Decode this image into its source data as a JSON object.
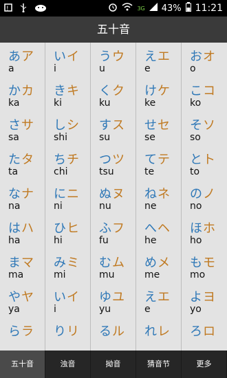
{
  "status": {
    "battery": "43%",
    "time": "11:21",
    "network": "3G"
  },
  "title": "五十音",
  "rows": [
    [
      {
        "h": "あ",
        "k": "ア",
        "r": "a"
      },
      {
        "h": "い",
        "k": "イ",
        "r": "i"
      },
      {
        "h": "う",
        "k": "ウ",
        "r": "u"
      },
      {
        "h": "え",
        "k": "エ",
        "r": "e"
      },
      {
        "h": "お",
        "k": "オ",
        "r": "o"
      }
    ],
    [
      {
        "h": "か",
        "k": "カ",
        "r": "ka"
      },
      {
        "h": "き",
        "k": "キ",
        "r": "ki"
      },
      {
        "h": "く",
        "k": "ク",
        "r": "ku"
      },
      {
        "h": "け",
        "k": "ケ",
        "r": "ke"
      },
      {
        "h": "こ",
        "k": "コ",
        "r": "ko"
      }
    ],
    [
      {
        "h": "さ",
        "k": "サ",
        "r": "sa"
      },
      {
        "h": "し",
        "k": "シ",
        "r": "shi"
      },
      {
        "h": "す",
        "k": "ス",
        "r": "su"
      },
      {
        "h": "せ",
        "k": "セ",
        "r": "se"
      },
      {
        "h": "そ",
        "k": "ソ",
        "r": "so"
      }
    ],
    [
      {
        "h": "た",
        "k": "タ",
        "r": "ta"
      },
      {
        "h": "ち",
        "k": "チ",
        "r": "chi"
      },
      {
        "h": "つ",
        "k": "ツ",
        "r": "tsu"
      },
      {
        "h": "て",
        "k": "テ",
        "r": "te"
      },
      {
        "h": "と",
        "k": "ト",
        "r": "to"
      }
    ],
    [
      {
        "h": "な",
        "k": "ナ",
        "r": "na"
      },
      {
        "h": "に",
        "k": "ニ",
        "r": "ni"
      },
      {
        "h": "ぬ",
        "k": "ヌ",
        "r": "nu"
      },
      {
        "h": "ね",
        "k": "ネ",
        "r": "ne"
      },
      {
        "h": "の",
        "k": "ノ",
        "r": "no"
      }
    ],
    [
      {
        "h": "は",
        "k": "ハ",
        "r": "ha"
      },
      {
        "h": "ひ",
        "k": "ヒ",
        "r": "hi"
      },
      {
        "h": "ふ",
        "k": "フ",
        "r": "fu"
      },
      {
        "h": "へ",
        "k": "ヘ",
        "r": "he"
      },
      {
        "h": "ほ",
        "k": "ホ",
        "r": "ho"
      }
    ],
    [
      {
        "h": "ま",
        "k": "マ",
        "r": "ma"
      },
      {
        "h": "み",
        "k": "ミ",
        "r": "mi"
      },
      {
        "h": "む",
        "k": "ム",
        "r": "mu"
      },
      {
        "h": "め",
        "k": "メ",
        "r": "me"
      },
      {
        "h": "も",
        "k": "モ",
        "r": "mo"
      }
    ],
    [
      {
        "h": "や",
        "k": "ヤ",
        "r": "ya"
      },
      {
        "h": "い",
        "k": "イ",
        "r": "i"
      },
      {
        "h": "ゆ",
        "k": "ユ",
        "r": "yu"
      },
      {
        "h": "え",
        "k": "エ",
        "r": "e"
      },
      {
        "h": "よ",
        "k": "ヨ",
        "r": "yo"
      }
    ],
    [
      {
        "h": "ら",
        "k": "ラ",
        "r": ""
      },
      {
        "h": "り",
        "k": "リ",
        "r": ""
      },
      {
        "h": "る",
        "k": "ル",
        "r": ""
      },
      {
        "h": "れ",
        "k": "レ",
        "r": ""
      },
      {
        "h": "ろ",
        "k": "ロ",
        "r": ""
      }
    ]
  ],
  "tabs": [
    "五十音",
    "浊音",
    "拗音",
    "猜音节",
    "更多"
  ],
  "active_tab": 0,
  "colors": {
    "hiragana": "#2f78b7",
    "katakana": "#c07a22"
  }
}
